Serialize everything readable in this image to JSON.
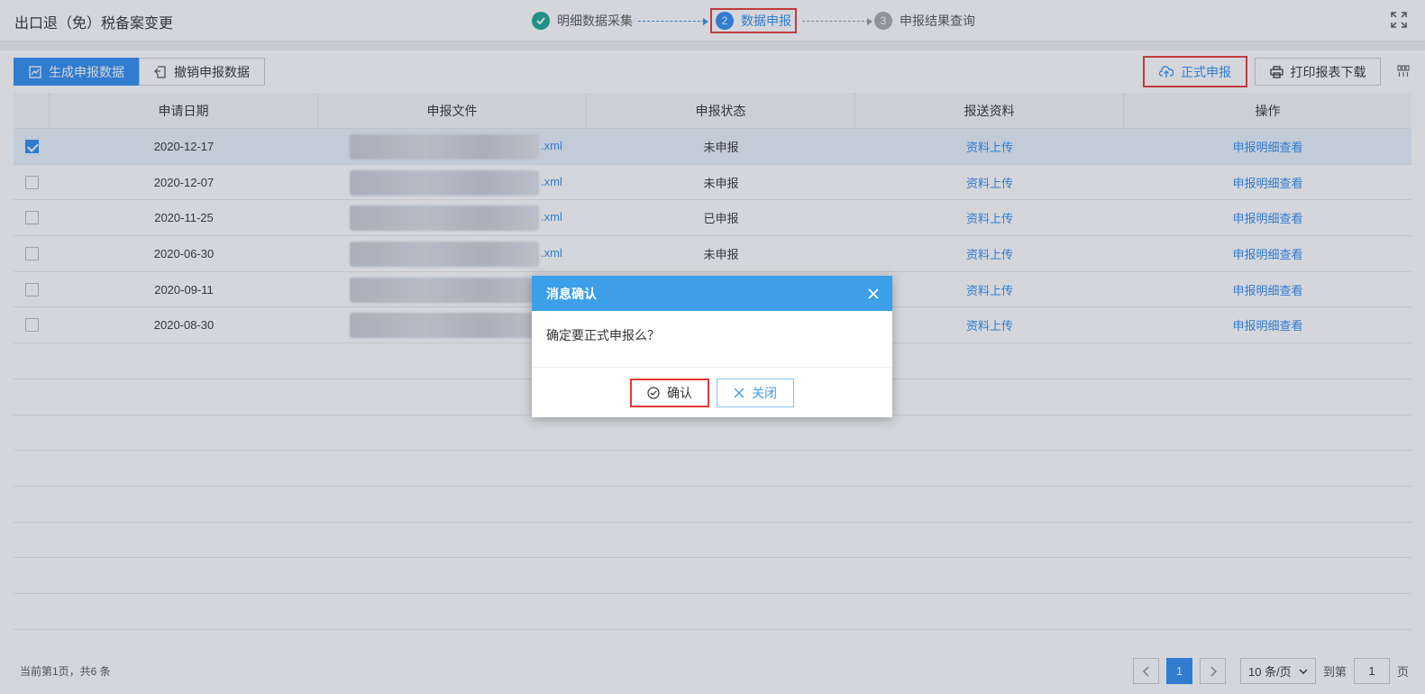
{
  "header": {
    "title": "出口退（免）税备案变更",
    "steps": [
      {
        "num": "",
        "label": "明细数据采集",
        "state": "done"
      },
      {
        "num": "2",
        "label": "数据申报",
        "state": "active"
      },
      {
        "num": "3",
        "label": "申报结果查询",
        "state": "todo"
      }
    ]
  },
  "toolbar": {
    "generate_label": "生成申报数据",
    "revoke_label": "撤销申报数据",
    "submit_label": "正式申报",
    "print_label": "打印报表下载"
  },
  "table": {
    "headers": [
      "申请日期",
      "申报文件",
      "申报状态",
      "报送资料",
      "操作"
    ],
    "rows": [
      {
        "date": "2020-12-17",
        "file_ext": ".xml",
        "status": "未申报",
        "material": "资料上传",
        "op": "申报明细查看",
        "checked": true
      },
      {
        "date": "2020-12-07",
        "file_ext": ".xml",
        "status": "未申报",
        "material": "资料上传",
        "op": "申报明细查看",
        "checked": false
      },
      {
        "date": "2020-11-25",
        "file_ext": ".xml",
        "status": "已申报",
        "material": "资料上传",
        "op": "申报明细查看",
        "checked": false
      },
      {
        "date": "2020-06-30",
        "file_ext": ".xml",
        "status": "未申报",
        "material": "资料上传",
        "op": "申报明细查看",
        "checked": false
      },
      {
        "date": "2020-09-11",
        "file_ext": "",
        "status": "",
        "material": "资料上传",
        "op": "申报明细查看",
        "checked": false
      },
      {
        "date": "2020-08-30",
        "file_ext": "",
        "status": "",
        "material": "资料上传",
        "op": "申报明细查看",
        "checked": false
      }
    ]
  },
  "footer": {
    "page_info": "当前第1页，共6 条",
    "current_page": "1",
    "page_size": "10 条/页",
    "goto_label": "到第",
    "goto_value": "1",
    "page_unit": "页"
  },
  "dialog": {
    "title": "消息确认",
    "message": "确定要正式申报么？",
    "ok_label": "确认",
    "cancel_label": "关闭"
  },
  "colors": {
    "accent": "#2d8cf0",
    "dialog_header": "#3d9fe8",
    "highlight_box": "#e53935",
    "step_done": "#1aa692"
  }
}
